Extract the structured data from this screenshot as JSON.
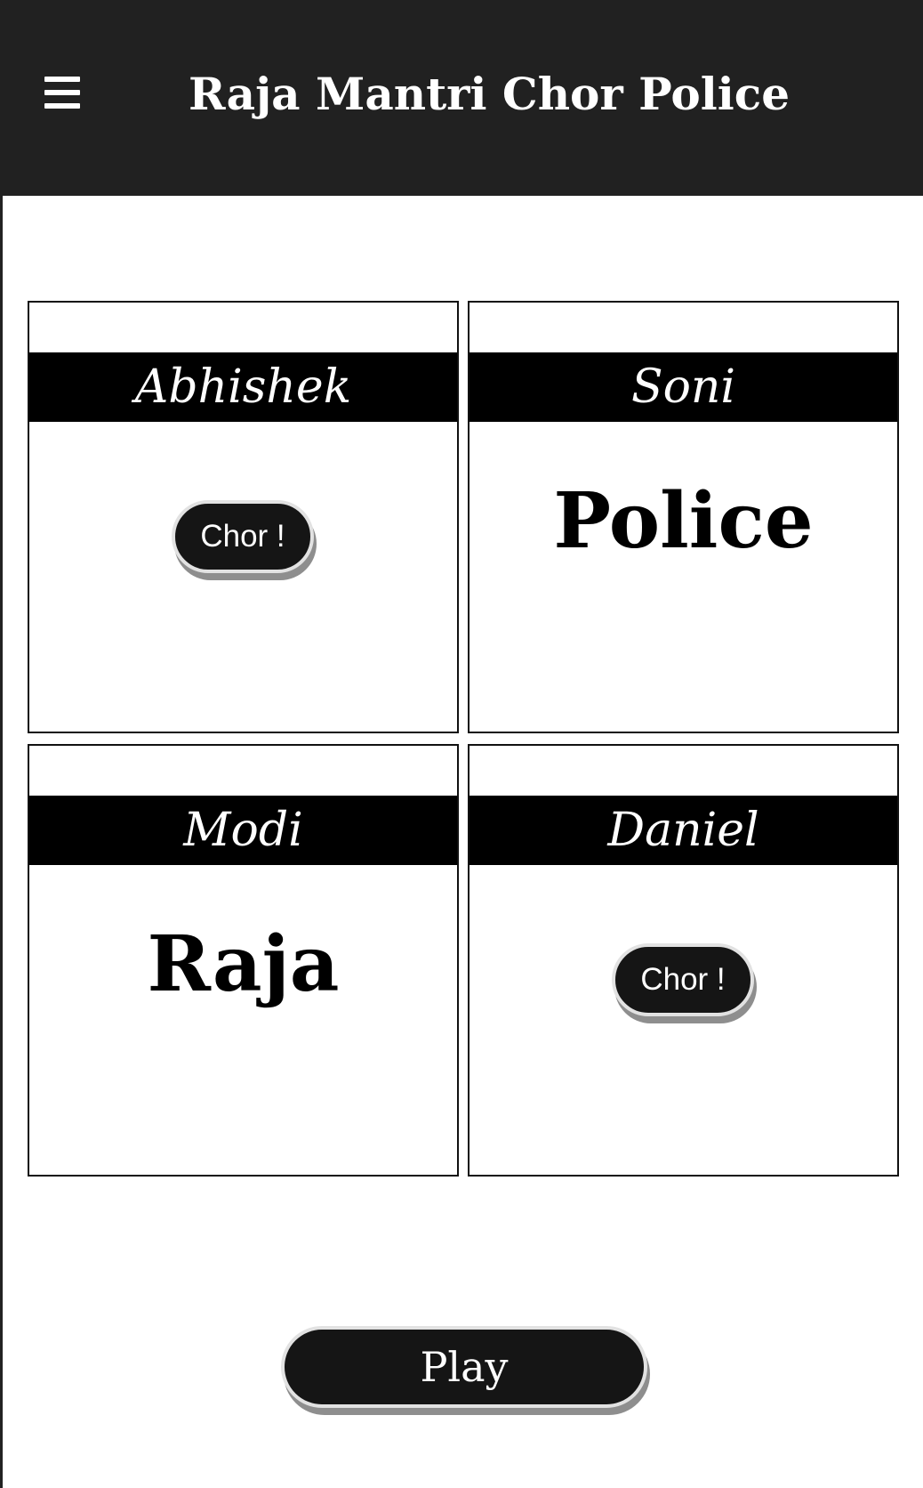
{
  "app_bar": {
    "title": "Raja Mantri Chor Police",
    "menu_icon": "hamburger-menu-icon",
    "background_color": "#212121"
  },
  "players": [
    {
      "name": "Abhishek",
      "role": "",
      "action_label": "Chor !"
    },
    {
      "name": "Soni",
      "role": "Police",
      "action_label": ""
    },
    {
      "name": "Modi",
      "role": "Raja",
      "action_label": ""
    },
    {
      "name": "Daniel",
      "role": "",
      "action_label": "Chor !"
    }
  ],
  "play_button": {
    "label": "Play"
  },
  "colors": {
    "name_bar": "#000000",
    "button": "#151515",
    "button_text": "#ffffff"
  }
}
